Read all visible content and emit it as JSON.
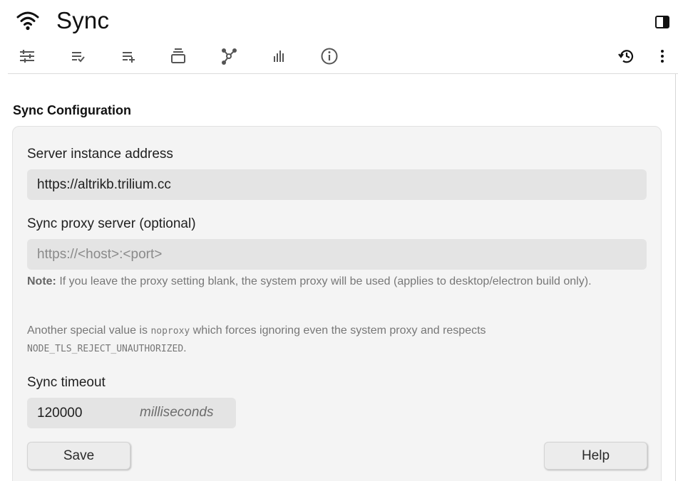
{
  "header": {
    "title": "Sync",
    "title_icon": "wifi-icon",
    "panel_toggle_icon": "split-panel-icon"
  },
  "toolbar": {
    "left_icons": [
      "sliders-icon",
      "list-check-icon",
      "list-add-icon",
      "stack-icon",
      "graph-icon",
      "bar-chart-icon",
      "info-icon"
    ],
    "right_icons": [
      "history-icon",
      "more-vertical-icon"
    ]
  },
  "section": {
    "title": "Sync Configuration"
  },
  "form": {
    "server_label": "Server instance address",
    "server_value": "https://altrikb.trilium.cc",
    "proxy_label": "Sync proxy server (optional)",
    "proxy_placeholder": "https://<host>:<port>",
    "note_prefix": "Note:",
    "note_text": " If you leave the proxy setting blank, the system proxy will be used (applies to desktop/electron build only).",
    "special_pre": "Another special value is ",
    "special_code": "noproxy",
    "special_post": " which forces ignoring even the system proxy and respects ",
    "special_code2": "NODE_TLS_REJECT_UNAUTHORIZED",
    "special_end": ".",
    "timeout_label": "Sync timeout",
    "timeout_value": "120000",
    "timeout_unit": "milliseconds",
    "save_label": "Save",
    "help_label": "Help"
  }
}
